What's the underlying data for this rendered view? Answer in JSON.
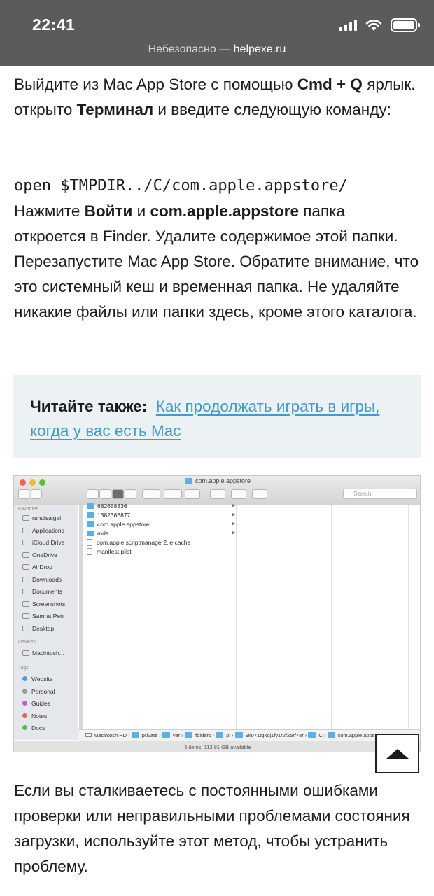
{
  "statusbar": {
    "time": "22:41",
    "url_prefix": "Небезопасно — ",
    "url_domain": "helpexe.ru"
  },
  "article": {
    "p1_a": "Выйдите из Mac App Store с помощью ",
    "p1_b": "Cmd + Q",
    "p1_c": " ярлык. открыто ",
    "p1_d": "Терминал",
    "p1_e": " и введите следующую команду:",
    "command": "open $TMPDIR../C/com.apple.appstore/",
    "p2_a": "Нажмите ",
    "p2_b": "Войти",
    "p2_c": " и ",
    "p2_d": "com.apple.appstore",
    "p2_e": " папка откроется в Finder. Удалите содержимое этой папки. Перезапустите Mac App Store. Обратите внимание, что это системный кеш и временная папка. Не удаляйте никакие файлы или папки здесь, кроме этого каталога.",
    "read_also_label": "Читайте также:",
    "read_also_link": "Как продолжать играть в игры, когда у вас есть Mac",
    "p3": "Если вы сталкиваетесь с постоянными ошибками проверки или неправильными проблемами состояния загрузки, используйте этот метод, чтобы устранить проблему."
  },
  "finder": {
    "title": "com.apple.appstore",
    "search_placeholder": "Search",
    "sidebar_favorites": "Favorites",
    "favorites": [
      "rahulsaigal",
      "Applications",
      "iCloud Drive",
      "OneDrive",
      "AirDrop",
      "Downloads",
      "Documents",
      "Screenshots",
      "Samrat Pen",
      "Desktop"
    ],
    "sidebar_devices": "Devices",
    "devices": [
      "Macintosh..."
    ],
    "sidebar_tags": "Tags",
    "tags": [
      {
        "name": "Website",
        "color": "#3aa3e8"
      },
      {
        "name": "Personal",
        "color": "#9a9a9a"
      },
      {
        "name": "Guides",
        "color": "#c060d0"
      },
      {
        "name": "Notes",
        "color": "#f06050"
      },
      {
        "name": "Docs",
        "color": "#4cc04c"
      }
    ],
    "files": [
      {
        "name": "682658836",
        "type": "folder"
      },
      {
        "name": "1382386877",
        "type": "folder"
      },
      {
        "name": "com.apple.appstore",
        "type": "folder"
      },
      {
        "name": "mds",
        "type": "folder"
      },
      {
        "name": "com.apple.scriptmanager2.le.cache",
        "type": "file"
      },
      {
        "name": "manifest.plist",
        "type": "file"
      }
    ],
    "path": [
      "Macintosh HD",
      "private",
      "var",
      "folders",
      "pl",
      "9k071tqx6j1fy1r2f25rf78r",
      "C",
      "com.apple.appstore"
    ],
    "status": "6 items, 112.81 GB available"
  }
}
